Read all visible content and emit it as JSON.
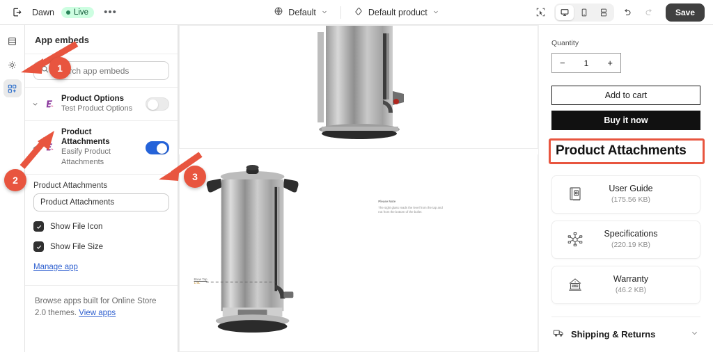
{
  "topbar": {
    "exit_icon": "exit-icon",
    "theme_name": "Dawn",
    "live_label": "Live",
    "more_label": "•••",
    "locale_selector": {
      "icon": "globe-icon",
      "label": "Default",
      "chevron": "chevron-down-icon"
    },
    "template_selector": {
      "icon": "tag-icon",
      "label": "Default product",
      "chevron": "chevron-down-icon"
    },
    "inspector_icon": "cursor-select-icon",
    "devices": [
      {
        "name": "desktop-icon",
        "active": true
      },
      {
        "name": "mobile-icon",
        "active": false
      },
      {
        "name": "fullscreen-icon",
        "active": false
      }
    ],
    "undo_icon": "undo-icon",
    "redo_icon": "redo-icon",
    "save_label": "Save"
  },
  "rail": {
    "items": [
      {
        "name": "sections-icon",
        "active": false
      },
      {
        "name": "settings-gear-icon",
        "active": false
      },
      {
        "name": "app-embeds-icon",
        "active": true
      }
    ]
  },
  "sidebar": {
    "title": "App embeds",
    "search": {
      "icon": "search-icon",
      "placeholder": "Search app embeds",
      "value": ""
    },
    "embeds": [
      {
        "chevron": "chevron-down-icon",
        "logo": "easify-app-icon",
        "name": "Product Options",
        "subtitle": "Test Product Options",
        "enabled": false
      },
      {
        "chevron": "chevron-up-icon",
        "logo": "easify-app-icon",
        "name": "Product Attachments",
        "subtitle": "Easify Product Attachments",
        "enabled": true
      }
    ],
    "settings": {
      "field_label": "Product Attachments",
      "field_value": "Product Attachments",
      "checkboxes": [
        {
          "label": "Show File Icon",
          "checked": true
        },
        {
          "label": "Show File Size",
          "checked": true
        }
      ],
      "manage_link": "Manage app"
    },
    "footer": {
      "text": "Browse apps built for Online Store 2.0 themes.",
      "link": "View apps"
    }
  },
  "preview": {
    "gallery": {
      "note_title": "Please Note",
      "note_body": "The sight glass reads the level from the tap and not from the bottom of the boiler.",
      "brew_label": "Brew Tap",
      "brew_value": "1.9L"
    },
    "product": {
      "quantity_label": "Quantity",
      "quantity_minus": "−",
      "quantity_value": "1",
      "quantity_plus": "+",
      "add_to_cart_label": "Add to cart",
      "buy_now_label": "Buy it now",
      "attachments_heading": "Product Attachments",
      "attachments": [
        {
          "icon": "user-guide-book-icon",
          "name": "User Guide",
          "size": "(175.56 KB)"
        },
        {
          "icon": "specifications-diagram-icon",
          "name": "Specifications",
          "size": "(220.19 KB)"
        },
        {
          "icon": "warranty-badge-icon",
          "name": "Warranty",
          "size": "(46.2 KB)"
        }
      ],
      "shipping": {
        "icon": "truck-icon",
        "label": "Shipping & Returns",
        "chevron": "chevron-down-icon"
      }
    }
  },
  "annotations": {
    "accent_color": "#e8553f",
    "badges": [
      {
        "number": "1",
        "target": "search-input"
      },
      {
        "number": "2",
        "target": "app-embed-toggle"
      },
      {
        "number": "3",
        "target": "heading-text-input"
      }
    ],
    "highlight_color": "#e8553f"
  },
  "colors": {
    "toggle_on": "#2563d9",
    "live_badge_bg": "#cdfee1",
    "save_button_bg": "#404040",
    "accent": "#e8553f"
  }
}
